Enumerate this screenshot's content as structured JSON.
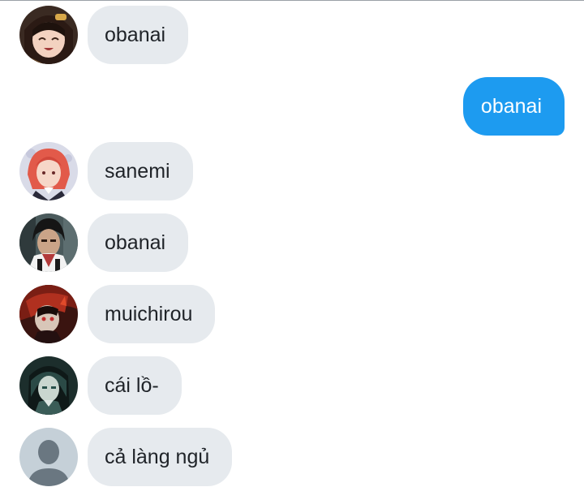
{
  "conversation": {
    "messages": [
      {
        "direction": "in",
        "avatar_icon": "anime-girl-avatar-icon",
        "text": "obanai"
      },
      {
        "direction": "out",
        "text": "obanai"
      },
      {
        "direction": "in",
        "avatar_icon": "pink-hair-character-avatar-icon",
        "text": "sanemi"
      },
      {
        "direction": "in",
        "avatar_icon": "dark-hair-character-avatar-icon",
        "text": "obanai"
      },
      {
        "direction": "in",
        "avatar_icon": "red-demon-character-avatar-icon",
        "text": "muichirou"
      },
      {
        "direction": "in",
        "avatar_icon": "dark-teal-character-avatar-icon",
        "text": "cái lồ-"
      },
      {
        "direction": "in",
        "avatar_icon": "default-user-avatar-icon",
        "text": "cả làng ngủ"
      }
    ]
  },
  "theme": {
    "incoming_bubble": "#e6eaee",
    "outgoing_bubble": "#1d9bf0",
    "outgoing_text": "#ffffff",
    "incoming_text": "#1f2328"
  }
}
